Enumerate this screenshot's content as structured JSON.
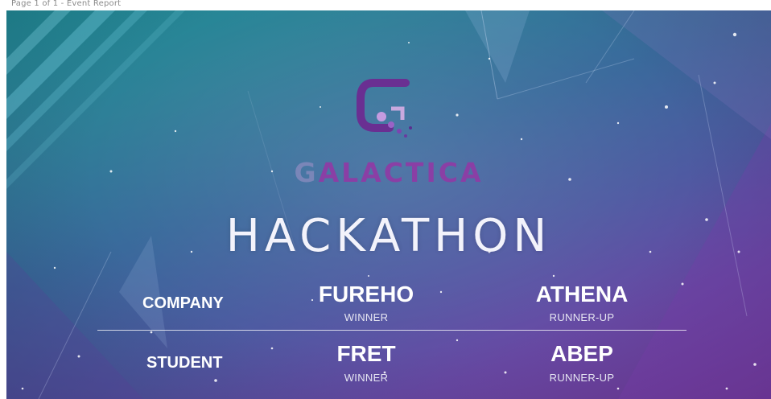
{
  "top_caption": "Page 1 of 1 - Event Report",
  "brand": {
    "name_first": "G",
    "name_rest": "ALACTICA"
  },
  "title": "HACKATHON",
  "results": {
    "company": {
      "label": "COMPANY",
      "winner": {
        "name": "FUREHO",
        "role": "WINNER"
      },
      "runner_up": {
        "name": "ATHENA",
        "role": "RUNNER-UP"
      }
    },
    "student": {
      "label": "STUDENT",
      "winner": {
        "name": "FRET",
        "role": "WINNER"
      },
      "runner_up": {
        "name": "ABEP",
        "role": "RUNNER-UP"
      }
    }
  },
  "colors": {
    "brand_purple": "#8a3fa5",
    "brand_grey": "#7a86b8",
    "text_white": "#ffffff"
  }
}
